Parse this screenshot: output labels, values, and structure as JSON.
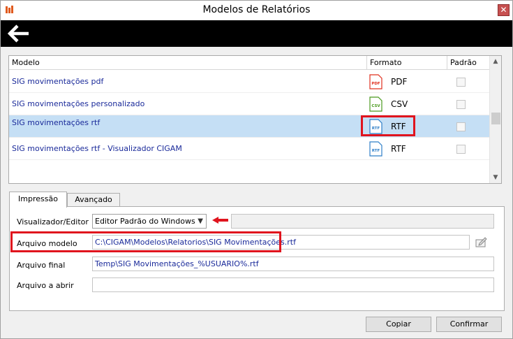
{
  "window": {
    "title": "Modelos de Relatórios",
    "close_glyph": "✕"
  },
  "toolbar": {
    "back_icon": "arrow-left-icon"
  },
  "grid": {
    "headers": {
      "model": "Modelo",
      "format": "Formato",
      "default": "Padrão"
    },
    "rows": [
      {
        "model": "SIG movimentações pdf",
        "format": "PDF",
        "icon_text": "PDF",
        "icon_color": "#e0301e",
        "default": false,
        "selected": false
      },
      {
        "model": "SIG movimentações personalizado",
        "format": "CSV",
        "icon_text": "CSV",
        "icon_color": "#4a9a1e",
        "default": false,
        "selected": false
      },
      {
        "model": "SIG movimentações rtf",
        "format": "RTF",
        "icon_text": "RTF",
        "icon_color": "#2f7fc8",
        "default": false,
        "selected": true
      },
      {
        "model": "SIG movimentações rtf - Visualizador CIGAM",
        "format": "RTF",
        "icon_text": "RTF",
        "icon_color": "#2f7fc8",
        "default": false,
        "selected": false
      }
    ]
  },
  "tabs": [
    {
      "label": "Impressão",
      "active": true
    },
    {
      "label": "Avançado",
      "active": false
    }
  ],
  "form": {
    "viewer_label": "Visualizador/Editor",
    "viewer_value": "Editor Padrão do Windows",
    "model_file_label": "Arquivo modelo",
    "model_file_value": "C:\\CIGAM\\Modelos\\Relatorios\\SIG Movimentações.rtf",
    "final_file_label": "Arquivo final",
    "final_file_value": "Temp\\SIG Movimentações_%USUARIO%.rtf",
    "open_file_label": "Arquivo a abrir",
    "open_file_value": ""
  },
  "buttons": {
    "copy": "Copiar",
    "confirm": "Confirmar"
  },
  "colors": {
    "highlight_red": "#e0141e",
    "selected_row": "#c5dff5",
    "link_blue": "#1a2a9a"
  }
}
